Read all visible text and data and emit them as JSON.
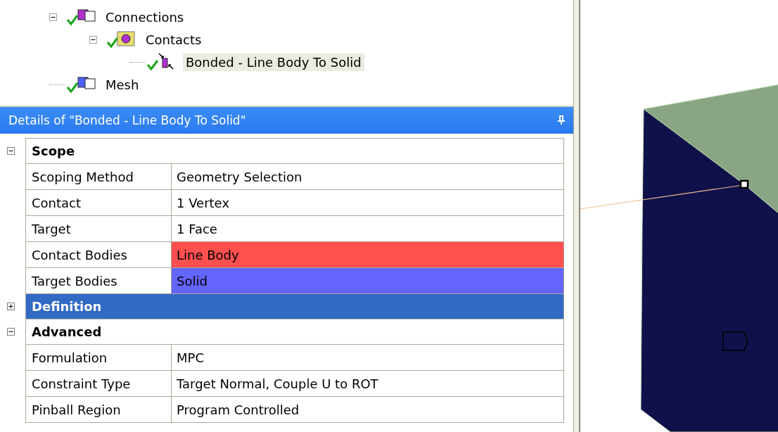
{
  "tree": [
    {
      "label": "Connections",
      "kind": "connections",
      "expanded": true,
      "selected": false,
      "children": [
        {
          "label": "Contacts",
          "kind": "folder",
          "expanded": true,
          "selected": false,
          "children": [
            {
              "label": "Bonded - Line Body To Solid",
              "kind": "contact",
              "selected": true
            }
          ]
        }
      ]
    },
    {
      "label": "Mesh",
      "kind": "mesh",
      "selected": false
    }
  ],
  "details": {
    "title": "Details of \"Bonded - Line Body To Solid\"",
    "groups": [
      {
        "name": "Scope",
        "expanded": true,
        "selected": false,
        "rows": [
          {
            "label": "Scoping Method",
            "value": "Geometry Selection"
          },
          {
            "label": "Contact",
            "value": "1 Vertex"
          },
          {
            "label": "Target",
            "value": "1 Face"
          },
          {
            "label": "Contact Bodies",
            "value": "Line Body",
            "color": "#ff5050"
          },
          {
            "label": "Target Bodies",
            "value": "Solid",
            "color": "#6464ff"
          }
        ]
      },
      {
        "name": "Definition",
        "expanded": false,
        "selected": true
      },
      {
        "name": "Advanced",
        "expanded": true,
        "selected": false,
        "rows": [
          {
            "label": "Formulation",
            "value": "MPC"
          },
          {
            "label": "Constraint Type",
            "value": "Target Normal, Couple U to ROT"
          },
          {
            "label": "Pinball Region",
            "value": "Program Controlled"
          }
        ]
      }
    ]
  }
}
